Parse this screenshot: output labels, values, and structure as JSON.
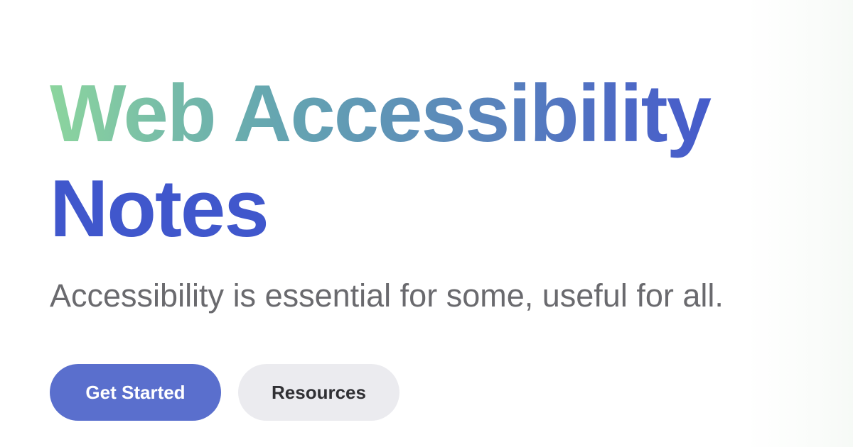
{
  "hero": {
    "title_line1": "Web Accessibility",
    "title_line2": "Notes",
    "tagline": "Accessibility is essential for some, useful for all."
  },
  "actions": {
    "primary_label": "Get Started",
    "secondary_label": "Resources"
  },
  "colors": {
    "gradient_start": "#8cd59e",
    "gradient_end": "#3f56cc",
    "title_solid": "#4057cc",
    "tagline_text": "#6a6a6e",
    "primary_button_bg": "#5a6fcd",
    "secondary_button_bg": "#ebebef"
  }
}
